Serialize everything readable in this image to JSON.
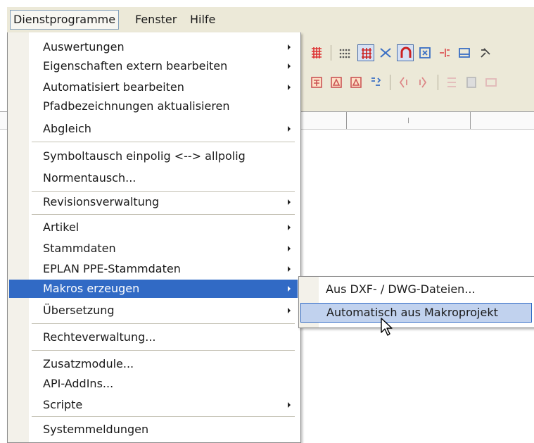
{
  "menubar": {
    "items": [
      {
        "label": "Dienstprogramme"
      },
      {
        "label": "Fenster"
      },
      {
        "label": "Hilfe"
      }
    ]
  },
  "menu": {
    "items": [
      {
        "label": "Auswertungen"
      },
      {
        "label": "Eigenschaften extern bearbeiten"
      },
      {
        "label": "Automatisiert bearbeiten"
      },
      {
        "label": "Pfadbezeichnungen aktualisieren"
      },
      {
        "label": "Abgleich"
      },
      {
        "label": "Symboltausch einpolig <--> allpolig"
      },
      {
        "label": "Normentausch..."
      },
      {
        "label": "Revisionsverwaltung"
      },
      {
        "label": "Artikel"
      },
      {
        "label": "Stammdaten"
      },
      {
        "label": "EPLAN PPE-Stammdaten"
      },
      {
        "label": "Makros erzeugen"
      },
      {
        "label": "Übersetzung"
      },
      {
        "label": "Rechteverwaltung..."
      },
      {
        "label": "Zusatzmodule..."
      },
      {
        "label": "API-AddIns..."
      },
      {
        "label": "Scripte"
      },
      {
        "label": "Systemmeldungen"
      }
    ]
  },
  "submenu": {
    "items": [
      {
        "label": "Aus DXF- / DWG-Dateien..."
      },
      {
        "label": "Automatisch aus Makroprojekt"
      }
    ]
  },
  "colors": {
    "highlight": "#316ac5",
    "submenu_selected": "#c1d2ee",
    "menubar_bg": "#ece9d8"
  }
}
